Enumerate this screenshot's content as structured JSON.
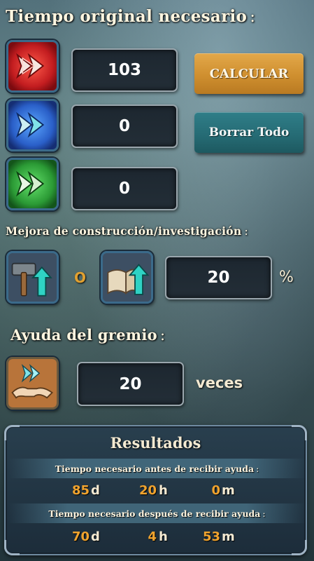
{
  "sections": {
    "original_time": {
      "title": "Tiempo original necesario",
      "colon": ":"
    },
    "upgrade": {
      "title": "Mejora de construcción/investigación",
      "colon": ":"
    },
    "guild_help": {
      "title": "Ayuda del gremio",
      "colon": ":"
    }
  },
  "speedups": [
    {
      "icon": "red-speedup-icon",
      "color": "#d8282a",
      "value": "103"
    },
    {
      "icon": "blue-speedup-icon",
      "color": "#2b6fd6",
      "value": "0"
    },
    {
      "icon": "green-speedup-icon",
      "color": "#2fae3a",
      "value": "0"
    }
  ],
  "buttons": {
    "calculate": "CALCULAR",
    "clear_all": "Borrar Todo"
  },
  "upgrade": {
    "build_icon": "hammer-upgrade-icon",
    "research_icon": "book-upgrade-icon",
    "or_label": "O",
    "value": "20",
    "unit": "%"
  },
  "guild_help": {
    "icon": "handshake-help-icon",
    "value": "20",
    "unit": "veces"
  },
  "results": {
    "title": "Resultados",
    "before_label": "Tiempo necesario antes de recibir ayuda",
    "after_label": "Tiempo necesario después de recibir ayuda",
    "colon": ":",
    "before": {
      "days": "85",
      "hours": "20",
      "minutes": "0"
    },
    "after": {
      "days": "70",
      "hours": "4",
      "minutes": "53"
    },
    "units": {
      "days": "d",
      "hours": "h",
      "minutes": "m"
    }
  },
  "colors": {
    "accent_orange": "#f0a32e",
    "calc_button": "#d8962f",
    "clear_button": "#2a7480"
  }
}
